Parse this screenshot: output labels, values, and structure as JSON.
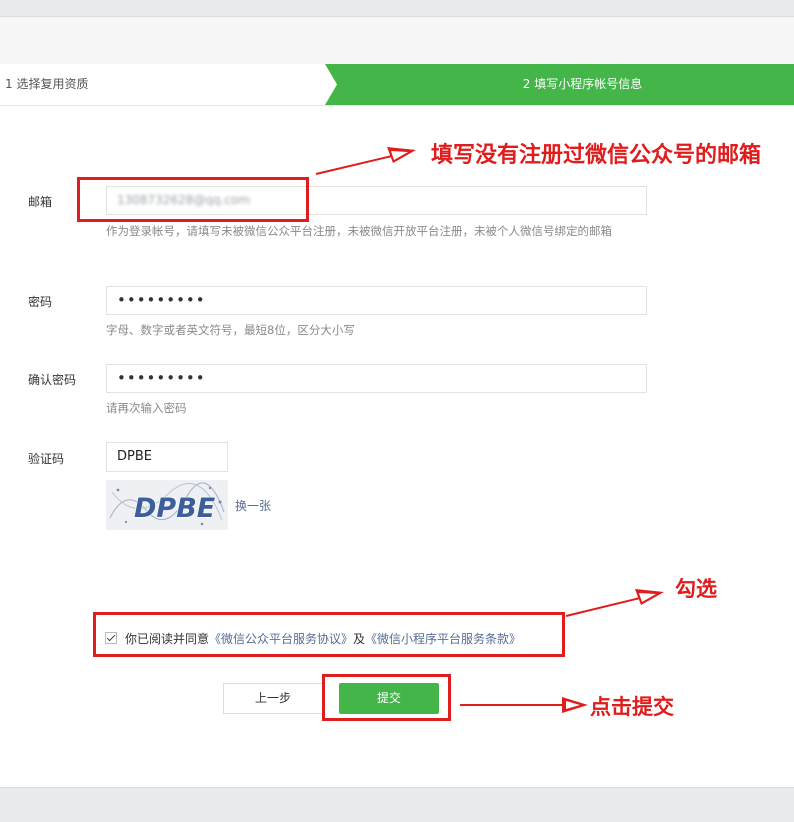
{
  "steps": {
    "step1": "1 选择复用资质",
    "step2": "2 填写小程序帐号信息"
  },
  "form": {
    "email": {
      "label": "邮箱",
      "value": "1308732628@qq.com",
      "hint": "作为登录帐号，请填写未被微信公众平台注册，未被微信开放平台注册，未被个人微信号绑定的邮箱"
    },
    "password": {
      "label": "密码",
      "value": "•••••••••",
      "hint": "字母、数字或者英文符号，最短8位，区分大小写"
    },
    "confirm_password": {
      "label": "确认密码",
      "value": "•••••••••",
      "hint": "请再次输入密码"
    },
    "captcha": {
      "label": "验证码",
      "value": "DPBE",
      "image_text": "DPBE",
      "refresh_label": "换一张"
    }
  },
  "agreement": {
    "prefix": "你已阅读并同意",
    "link1": "《微信公众平台服务协议》",
    "middle": "及",
    "link2": "《微信小程序平台服务条款》"
  },
  "buttons": {
    "prev": "上一步",
    "submit": "提交"
  },
  "annotations": {
    "email_note": "填写没有注册过微信公众号的邮箱",
    "check_note": "勾选",
    "submit_note": "点击提交"
  },
  "colors": {
    "accent_green": "#44b549",
    "annotation_red": "#e01d1d",
    "link_blue": "#576b95"
  }
}
